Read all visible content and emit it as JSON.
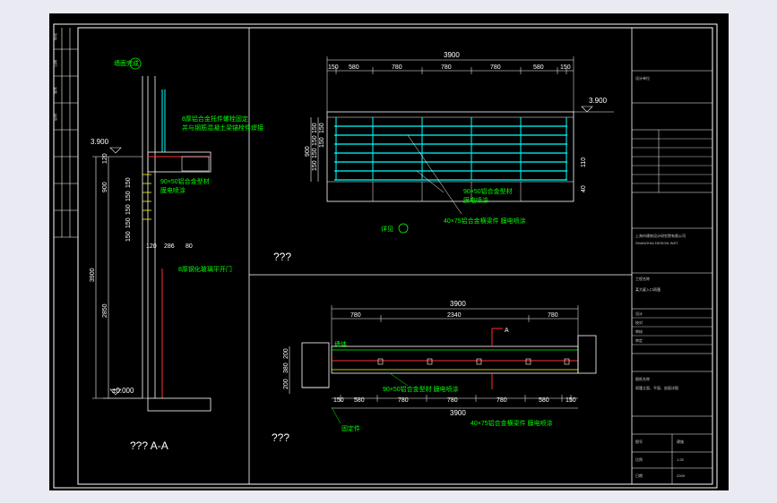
{
  "colors": {
    "background": "#e9eaf2",
    "sheet": "#000000",
    "frame": "#ffffff",
    "dimension": "#ffffff",
    "annotation": "#00ff00",
    "glass": "#00ffff",
    "rail": "#ff3030",
    "structure": "#ffff00"
  },
  "section": {
    "title": "??? A-A",
    "level_top": "3.900",
    "level_bottom": "±0.000",
    "dims_left": [
      "3900",
      "2850",
      "900",
      "120",
      "150",
      "150",
      "150",
      "150",
      "150"
    ],
    "dims_bottom": [
      "120",
      "286",
      "80"
    ],
    "notes": [
      "8厚铝合金托件螺栓固定",
      "并与钢筋混凝土梁锚栓件焊接",
      "90×50铝合金型材",
      "膜电喷涂",
      "8厚钢化玻璃平开门",
      "墙面完成"
    ]
  },
  "elevation": {
    "title": "???",
    "total": "3900",
    "level": "3.900",
    "dims_top": [
      "150",
      "580",
      "780",
      "780",
      "780",
      "580",
      "150"
    ],
    "dims_left": [
      "900",
      "150",
      "150",
      "150",
      "150",
      "150",
      "150"
    ],
    "dims_right": [
      "110",
      "40"
    ],
    "notes": [
      "90×50铝合金型材",
      "膜电喷涂",
      "40×75铝合金横梁件 膜电喷涂",
      "详见"
    ]
  },
  "plan": {
    "title": "???",
    "total_top": "3900",
    "dims_top": [
      "780",
      "2340",
      "780"
    ],
    "total_bottom": "3900",
    "dims_bottom": [
      "150",
      "580",
      "780",
      "780",
      "780",
      "580",
      "150"
    ],
    "dims_left": [
      "200",
      "380",
      "200"
    ],
    "cut_mark": "A",
    "notes": [
      "90×50铝合金型材 膜电喷涂",
      "40×75铝合金横梁件 膜电喷涂",
      "墙体",
      "固定件"
    ]
  },
  "title_block": {
    "rows": [
      "设计单位",
      "上海市建筑设计研究院有限公司",
      "SHANGHAI DESIGN INST.",
      "工程名称",
      "某大厦入口雨篷",
      "图纸名称",
      "雨篷立面、平面、剖面详图",
      "设计",
      "校对",
      "审核",
      "审定",
      "图号",
      "比例",
      "日期"
    ],
    "values": [
      "建施",
      "1:25",
      "2009"
    ]
  },
  "left_strip": [
    "修改",
    "日期",
    "版本",
    "说明"
  ]
}
